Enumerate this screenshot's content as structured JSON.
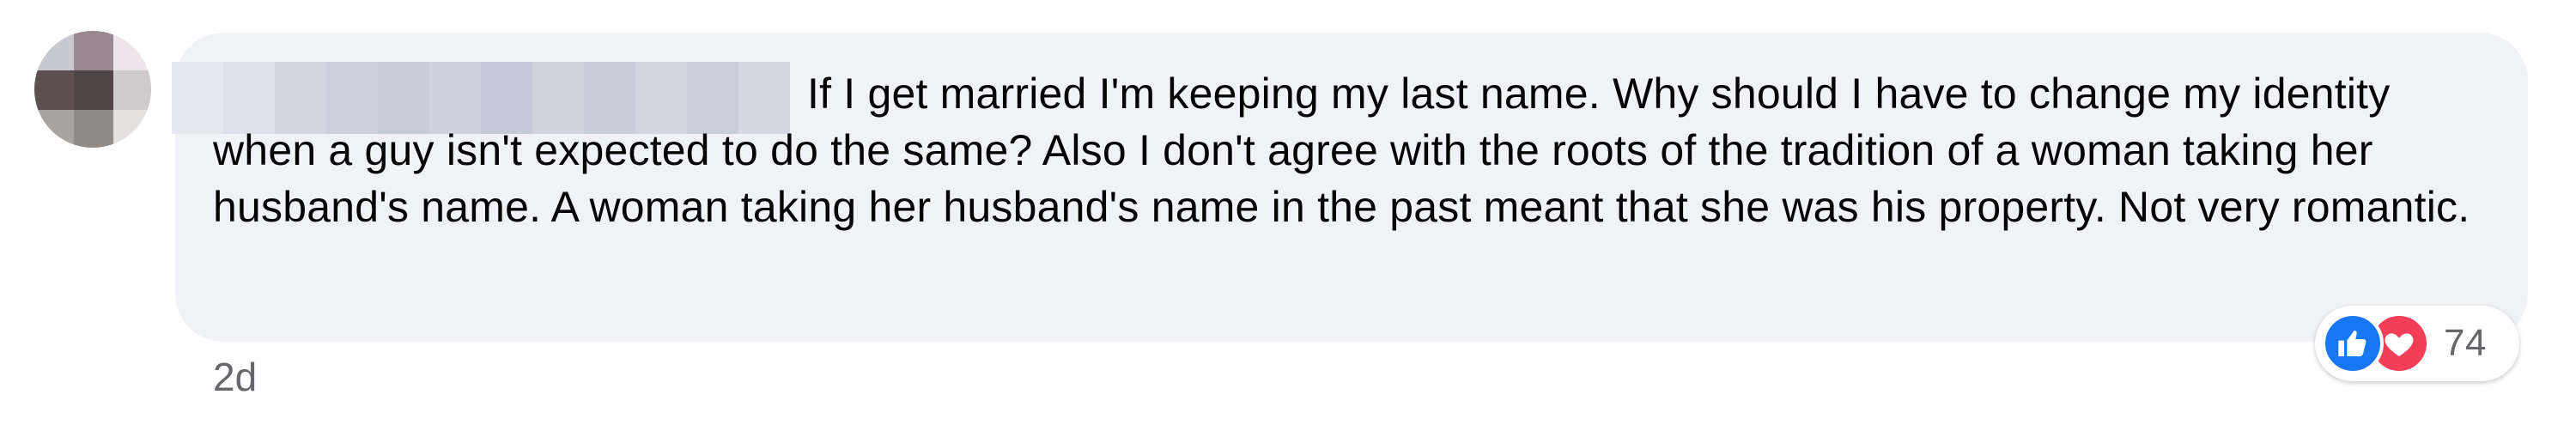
{
  "comment": {
    "text": "If I get married I'm keeping my last name. Why should I have to change my identity when a guy isn't expected to do the same? Also I don't agree with the roots of the tradition of a woman taking her husband's name. A woman taking her husband's name in the past meant that she was his property. Not very romantic.",
    "timestamp": "2d"
  },
  "reactions": {
    "count": "74",
    "icons": [
      "like-icon",
      "love-icon"
    ]
  },
  "colors": {
    "bubble": "#f0f2f5",
    "text": "#050505",
    "meta": "#65676b",
    "like": "#1877f2",
    "love": "#f33e58"
  }
}
